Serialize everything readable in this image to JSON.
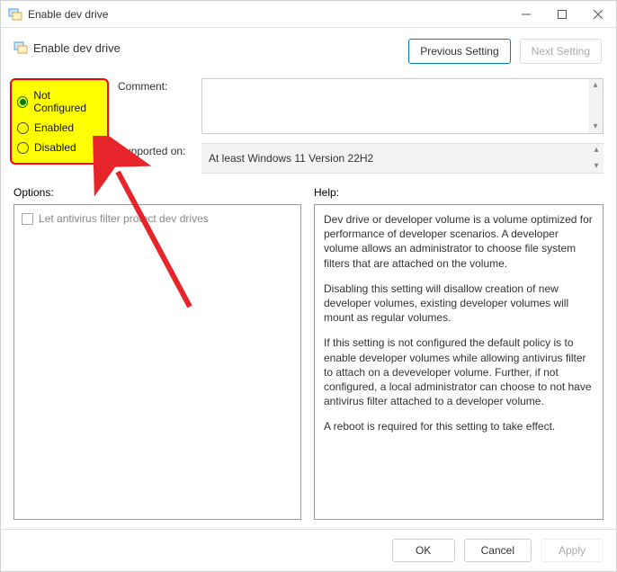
{
  "titlebar": {
    "title": "Enable dev drive"
  },
  "header": {
    "title": "Enable dev drive"
  },
  "nav": {
    "prev": "Previous Setting",
    "next": "Next Setting"
  },
  "radios": {
    "not_configured": "Not Configured",
    "enabled": "Enabled",
    "disabled": "Disabled",
    "selected": "not_configured"
  },
  "form": {
    "comment_label": "Comment:",
    "supported_label": "Supported on:",
    "supported_value": "At least Windows 11 Version 22H2"
  },
  "labels": {
    "options": "Options:",
    "help": "Help:"
  },
  "options": {
    "antivirus_checkbox": "Let antivirus filter protect dev drives"
  },
  "help": {
    "p1": "Dev drive or developer volume is a volume optimized for performance of developer scenarios. A developer volume allows an administrator to choose file system filters that are attached on the volume.",
    "p2": "Disabling this setting will disallow creation of new developer volumes, existing developer volumes will mount as regular volumes.",
    "p3": "If this setting is not configured the default policy is to enable developer volumes while allowing antivirus filter to attach on a deveveloper volume.  Further, if not configured, a local administrator can choose to not have antivirus filter attached to a developer volume.",
    "p4": "A reboot is required for this setting to take effect."
  },
  "footer": {
    "ok": "OK",
    "cancel": "Cancel",
    "apply": "Apply"
  }
}
